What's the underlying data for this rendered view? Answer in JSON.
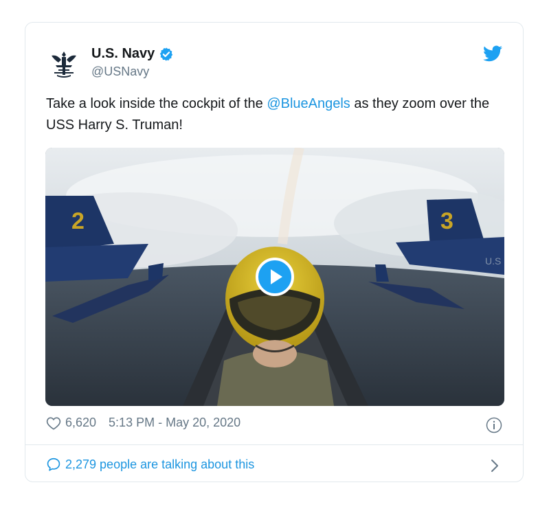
{
  "account": {
    "name": "U.S. Navy",
    "handle": "@USNavy",
    "verified": true
  },
  "tweet": {
    "text_before": "Take a look inside the cockpit of the ",
    "mention": "@BlueAngels",
    "text_after": " as they zoom over the USS Harry S. Truman!"
  },
  "media": {
    "type": "video",
    "play_icon": "play-icon",
    "content": "Blue Angels cockpit view with jets in formation"
  },
  "meta": {
    "likes": "6,620",
    "timestamp": "5:13 PM - May 20, 2020"
  },
  "conversation": {
    "label": "2,279 people are talking about this"
  },
  "colors": {
    "brand": "#1da1f2",
    "link": "#1b95e0",
    "muted": "#657786",
    "border": "#e1e8ed"
  }
}
